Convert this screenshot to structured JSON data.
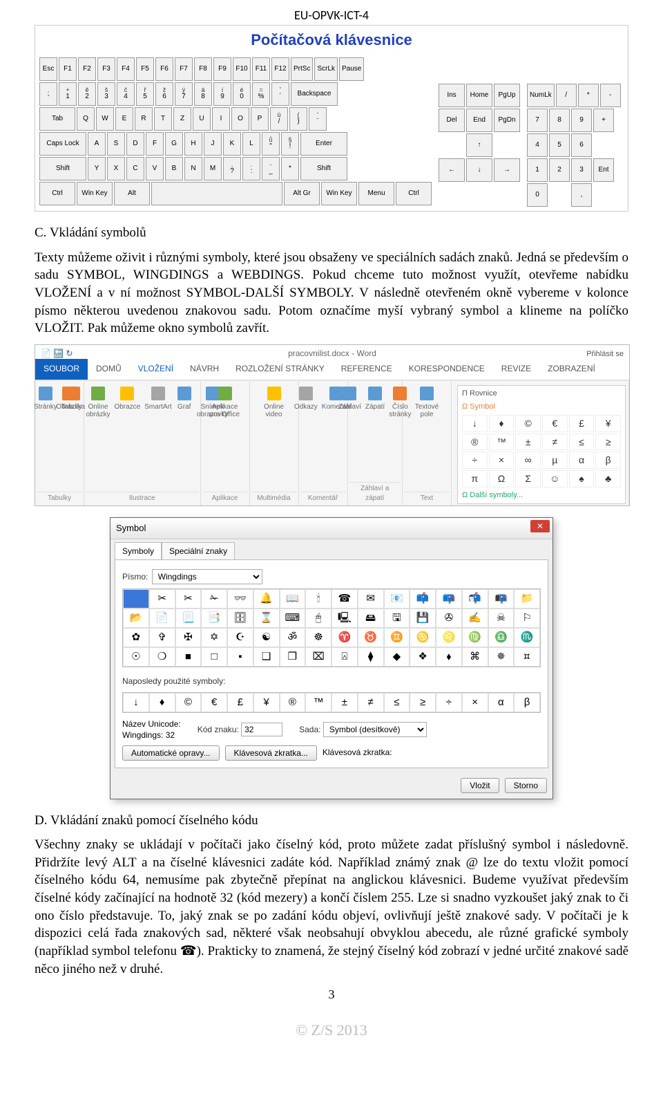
{
  "header": "EU-OPVK-ICT-4",
  "keyboard": {
    "title": "Počítačová klávesnice",
    "rows_main": [
      [
        "Esc",
        "F1",
        "F2",
        "F3",
        "F4",
        "F5",
        "F6",
        "F7",
        "F8",
        "F9",
        "F10",
        "F11",
        "F12",
        "PrtSc",
        "ScrLk",
        "Pause"
      ],
      [
        ";",
        "+\n1",
        "ě\n2",
        "š\n3",
        "č\n4",
        "ř\n5",
        "ž\n6",
        "ý\n7",
        "á\n8",
        "í\n9",
        "é\n0",
        "=\n%",
        "ˇ\n´",
        "Backspace"
      ],
      [
        "Tab",
        "Q",
        "W",
        "E",
        "R",
        "T",
        "Z",
        "U",
        "I",
        "O",
        "P",
        "ú\n/",
        "(\n)",
        "'\n¨"
      ],
      [
        "Caps Lock",
        "A",
        "S",
        "D",
        "F",
        "G",
        "H",
        "J",
        "K",
        "L",
        "ů\n\"",
        "§\n!",
        "Enter"
      ],
      [
        "Shift",
        "Y",
        "X",
        "C",
        "V",
        "B",
        "N",
        "M",
        ",\n?",
        ".\n:",
        "-\n_",
        "*",
        "Shift"
      ],
      [
        "Ctrl",
        "Win Key",
        "Alt",
        "",
        "Alt Gr",
        "Win Key",
        "Menu",
        "Ctrl"
      ]
    ],
    "nav": [
      [
        "Ins",
        "Home",
        "PgUp"
      ],
      [
        "Del",
        "End",
        "PgDn"
      ],
      [
        "",
        "↑",
        ""
      ],
      [
        "←",
        "↓",
        "→"
      ]
    ],
    "numpad": [
      [
        "NumLk",
        "/",
        "*",
        "-"
      ],
      [
        "7",
        "8",
        "9",
        "+"
      ],
      [
        "4",
        "5",
        "6",
        ""
      ],
      [
        "1",
        "2",
        "3",
        "Ent"
      ],
      [
        "0",
        "",
        ",",
        ""
      ]
    ]
  },
  "section_c": {
    "title": "C. Vkládání symbolů",
    "para": "Texty můžeme oživit i různými symboly, které jsou obsaženy ve speciálních sadách znaků. Jedná se především o sadu SYMBOL, WINGDINGS a WEBDINGS. Pokud chceme tuto možnost využít, otevřeme nabídku VLOŽENÍ a v ní možnost SYMBOL-DALŠÍ SYMBOLY. V následně otevřeném okně vybereme v kolonce písmo některou uvedenou znakovou sadu. Potom označíme myší vybraný symbol a klineme na políčko VLOŽIT. Pak můžeme okno symbolů zavřít."
  },
  "ribbon": {
    "doc_title": "pracovnilist.docx - Word",
    "tabs": [
      "SOUBOR",
      "DOMŮ",
      "VLOŽENÍ",
      "NÁVRH",
      "ROZLOŽENÍ STRÁNKY",
      "REFERENCE",
      "KORESPONDENCE",
      "REVIZE",
      "ZOBRAZENÍ"
    ],
    "signin": "Přihlásit se",
    "groups": {
      "tabulky": {
        "items": [
          "Stránky",
          "Tabulka"
        ],
        "name": "Tabulky"
      },
      "ilustrace": {
        "items": [
          "Obrázky",
          "Online obrázky",
          "Obrazce",
          "SmartArt",
          "Graf",
          "Snímek obrazovky"
        ],
        "name": "Ilustrace"
      },
      "aplikace": {
        "items": [
          "Aplikace pro Office"
        ],
        "name": "Aplikace"
      },
      "multimedia": {
        "items": [
          "Online video"
        ],
        "name": "Multimédia"
      },
      "odkazy": {
        "items": [
          "Odkazy",
          "Komentář"
        ],
        "name": "Komentář"
      },
      "zahlavi": {
        "items": [
          "Záhlaví",
          "Zápatí",
          "Číslo stránky"
        ],
        "name": "Záhlaví a zápatí"
      },
      "text": {
        "items": [
          "Textové pole"
        ],
        "name": "Text"
      }
    },
    "sym_drop": {
      "rovnice": "Π Rovnice",
      "symbol": "Ω Symbol",
      "grid": [
        "↓",
        "♦",
        "©",
        "€",
        "£",
        "¥",
        "®",
        "™",
        "±",
        "≠",
        "≤",
        "≥",
        "÷",
        "×",
        "∞",
        "µ",
        "α",
        "β",
        "π",
        "Ω",
        "Σ",
        "☺",
        "♠",
        "♣"
      ],
      "more": "Ω  Další symboly..."
    }
  },
  "dialog": {
    "title": "Symbol",
    "tabs": [
      "Symboly",
      "Speciální znaky"
    ],
    "font_label": "Písmo:",
    "font_value": "Wingdings",
    "chargrid_rows": [
      [
        " ",
        "✂",
        "✂",
        "✁",
        "👓",
        "🔔",
        "📖",
        "🕯",
        "☎",
        "✉",
        "📧",
        "📫",
        "📪",
        "📬",
        "📭",
        "📁"
      ],
      [
        "📂",
        "📄",
        "📃",
        "📑",
        "🗄",
        "⌛",
        "⌨",
        "🖰",
        "🖳",
        "🖴",
        "🖫",
        "💾",
        "✇",
        "✍",
        "☠",
        "⚐"
      ],
      [
        "✿",
        "✞",
        "✠",
        "✡",
        "☪",
        "☯",
        "ॐ",
        "☸",
        "♈",
        "♉",
        "♊",
        "♋",
        "♌",
        "♍",
        "♎",
        "♏"
      ],
      [
        "☉",
        "❍",
        "■",
        "□",
        "▪",
        "❑",
        "❒",
        "⌧",
        "⍓",
        "⧫",
        "◆",
        "❖",
        "⬧",
        "⌘",
        "✵",
        "⯏"
      ]
    ],
    "recent_label": "Naposledy použité symboly:",
    "recent": [
      "↓",
      "♦",
      "©",
      "€",
      "£",
      "¥",
      "®",
      "™",
      "±",
      "≠",
      "≤",
      "≥",
      "÷",
      "×",
      "α",
      "β"
    ],
    "unicode_name_label": "Název Unicode:",
    "unicode_name": "Wingdings: 32",
    "code_label": "Kód znaku:",
    "code_value": "32",
    "sada_label": "Sada:",
    "sada_value": "Symbol (desítkově)",
    "autocorrect": "Automatické opravy...",
    "shortcut_btn": "Klávesová zkratka...",
    "shortcut_label": "Klávesová zkratka:",
    "insert": "Vložit",
    "cancel": "Storno"
  },
  "section_d": {
    "title": "D. Vkládání znaků pomocí číselného kódu",
    "para": "Všechny znaky se ukládají v počítači jako číselný kód, proto můžete zadat příslušný symbol i následovně. Přidržíte levý ALT a na číselné klávesnici zadáte kód. Například známý znak @ lze do textu vložit pomocí číselného kódu 64, nemusíme pak zbytečně přepínat na anglickou klávesnici. Budeme využívat především číselné kódy začínající na hodnotě 32 (kód mezery) a končí číslem 255. Lze si snadno vyzkoušet jaký znak to či ono číslo představuje. To, jaký znak se po zadání kódu objeví, ovlivňují ještě znakové sady. V počítači je k dispozici celá řada znakových sad, některé však neobsahují obvyklou abecedu, ale různé grafické symboly (například symbol telefonu ☎). Prakticky to znamená, že stejný číselný kód zobrazí v jedné určité znakové sadě něco jiného než v druhé."
  },
  "page_number": "3",
  "copyright": "© Z/S 2013"
}
